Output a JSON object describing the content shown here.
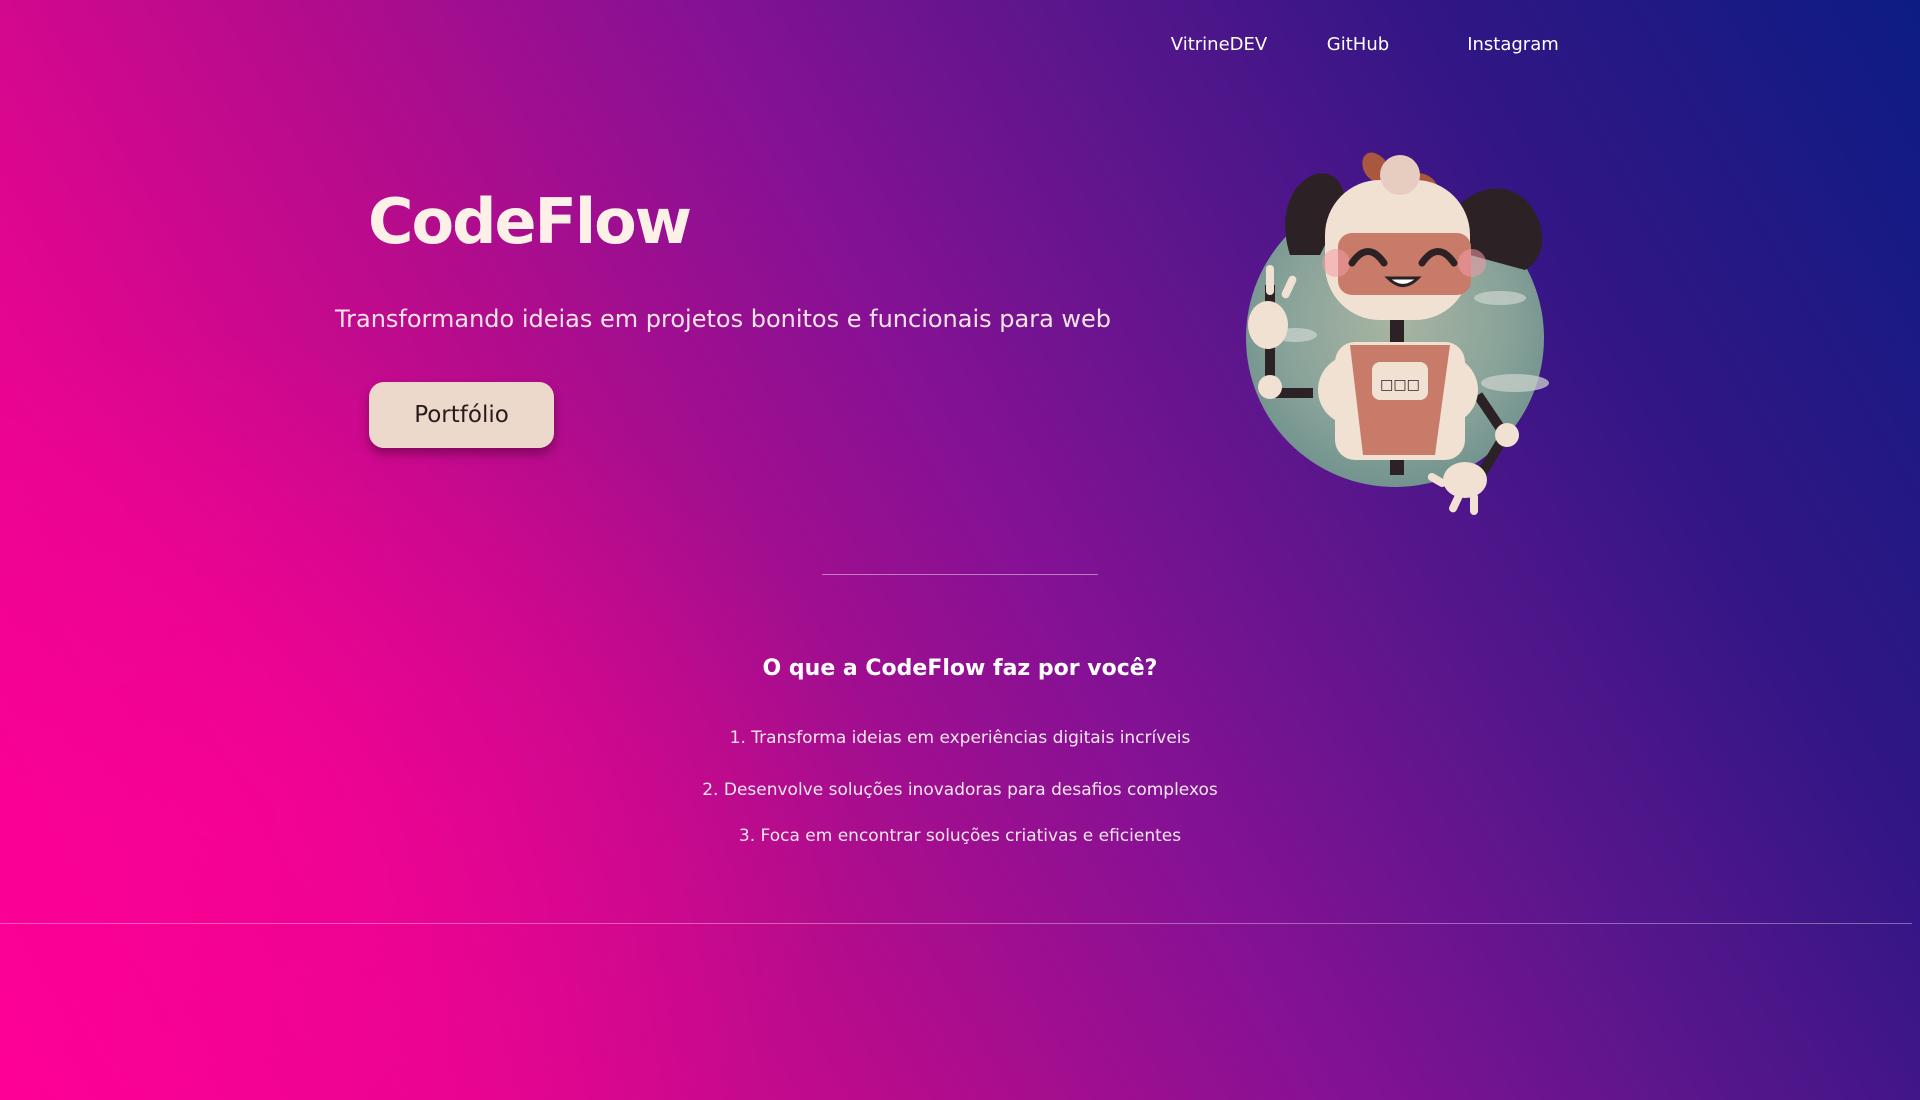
{
  "nav": {
    "links": [
      {
        "label": "VitrineDEV"
      },
      {
        "label": "GitHub"
      },
      {
        "label": "Instagram"
      }
    ]
  },
  "hero": {
    "title": "CodeFlow",
    "tagline": "Transformando ideias em projetos bonitos e funcionais para web",
    "button_label": "Portfólio"
  },
  "services": {
    "heading": "O que a CodeFlow faz por você?",
    "items": [
      "1. Transforma ideias em experiências digitais incríveis",
      "2. Desenvolve soluções inovadoras para desafios complexos",
      "3. Foca em encontrar soluções criativas e eficientes"
    ]
  },
  "colors": {
    "gradient_start": "#ff0096",
    "gradient_end": "#0c1c83",
    "button_bg": "#ecd9cb",
    "title": "#fdf0e6"
  },
  "icons": {
    "mascot": "robot-girl-mascot-illustration"
  }
}
